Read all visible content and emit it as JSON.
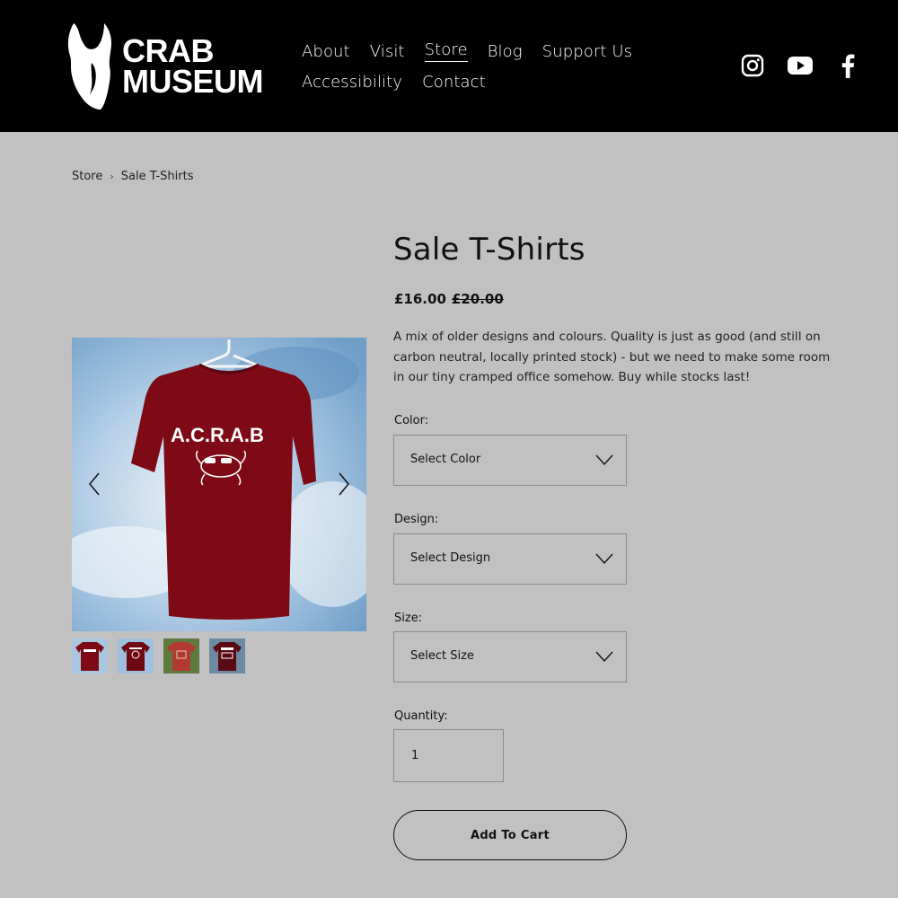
{
  "header": {
    "logo": {
      "line1": "CRAB",
      "line2": "MUSEUM"
    },
    "nav_row1": [
      "About",
      "Visit",
      "Store",
      "Blog",
      "Support Us"
    ],
    "nav_row2": [
      "Accessibility",
      "Contact"
    ],
    "active_nav": "Store",
    "social": [
      "instagram-icon",
      "youtube-icon",
      "facebook-icon"
    ]
  },
  "breadcrumb": {
    "parent": "Store",
    "separator": "›",
    "current": "Sale T-Shirts"
  },
  "gallery": {
    "main_image": "tshirt-photo",
    "shirt_print_text": "A.C.R.A.B",
    "thumbnails": [
      "thumbnail-1",
      "thumbnail-2",
      "thumbnail-3",
      "thumbnail-4"
    ]
  },
  "product": {
    "title": "Sale T-Shirts",
    "price": "£16.00",
    "original_price": "£20.00",
    "description": "A mix of older designs and colours. Quality is just as good (and still on carbon neutral, locally printed stock) - but we need to make some room in our tiny cramped office somehow. Buy while stocks last!"
  },
  "options": {
    "color": {
      "label": "Color:",
      "value": "Select Color"
    },
    "design": {
      "label": "Design:",
      "value": "Select Design"
    },
    "size": {
      "label": "Size:",
      "value": "Select Size"
    }
  },
  "quantity": {
    "label": "Quantity:",
    "value": "1"
  },
  "cart_button": "Add To Cart",
  "colors": {
    "header_bg": "#000000",
    "page_bg": "#c1c1c1",
    "shirt": "#7e0a16",
    "text": "#111111"
  }
}
